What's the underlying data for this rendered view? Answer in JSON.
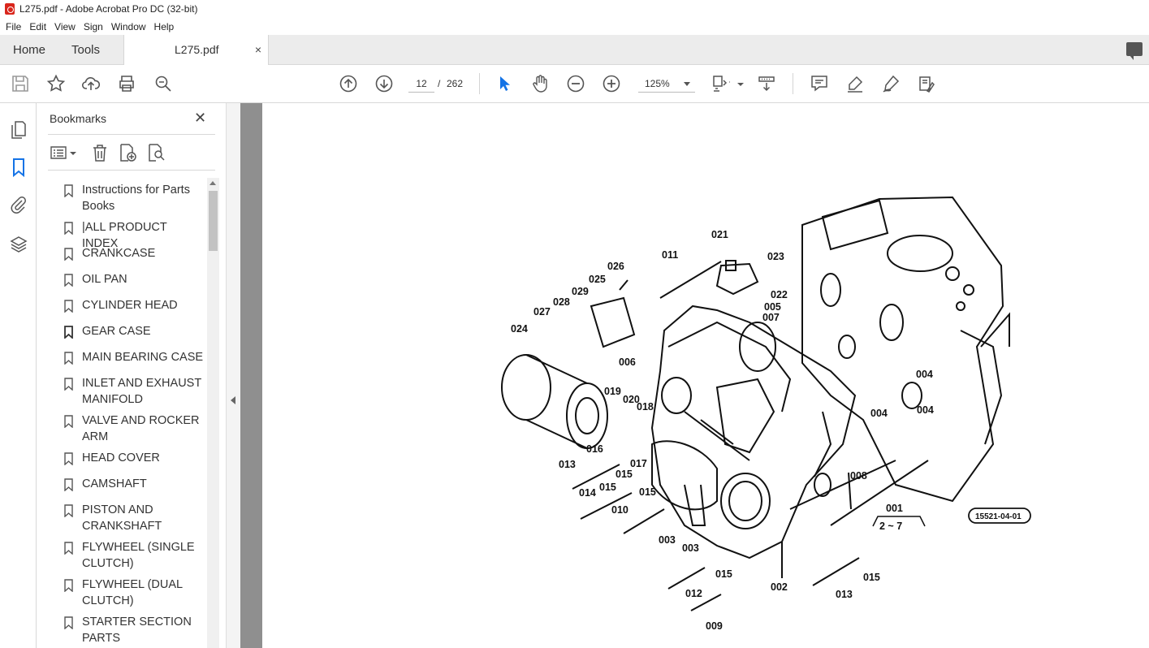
{
  "window": {
    "title": "L275.pdf - Adobe Acrobat Pro DC (32-bit)"
  },
  "menu": [
    "File",
    "Edit",
    "View",
    "Sign",
    "Window",
    "Help"
  ],
  "tabs": {
    "home": "Home",
    "tools": "Tools",
    "document": "L275.pdf",
    "close": "×"
  },
  "toolbar": {
    "page_current": "12",
    "page_separator": "/",
    "page_total": "262",
    "zoom": "125%"
  },
  "bookmarks": {
    "title": "Bookmarks",
    "close": "✕",
    "items": [
      "Instructions for Parts Books",
      "|ALL PRODUCT INDEX",
      "CRANKCASE",
      "OIL PAN",
      "CYLINDER HEAD",
      "GEAR CASE",
      "MAIN BEARING CASE",
      "INLET AND EXHAUST MANIFOLD",
      "VALVE AND ROCKER ARM",
      "HEAD COVER",
      "CAMSHAFT",
      "PISTON AND CRANKSHAFT",
      "FLYWHEEL (SINGLE CLUTCH)",
      "FLYWHEEL (DUAL CLUTCH)",
      "STARTER SECTION PARTS"
    ]
  },
  "diagram": {
    "part_labels": [
      "021",
      "023",
      "011",
      "026",
      "022",
      "025",
      "005",
      "029",
      "007",
      "028",
      "027",
      "024",
      "006",
      "004",
      "019",
      "020",
      "018",
      "004",
      "004",
      "016",
      "017",
      "013",
      "015",
      "015",
      "014",
      "015",
      "008",
      "010",
      "001",
      "003",
      "003",
      "015",
      "015",
      "012",
      "002",
      "013",
      "009"
    ],
    "group_ref": "2 ~ 7",
    "figure_code": "15521-04-01"
  },
  "colors": {
    "accent": "#1473e6",
    "doc_background": "#8f8f8f",
    "tab_background": "#ececec"
  }
}
